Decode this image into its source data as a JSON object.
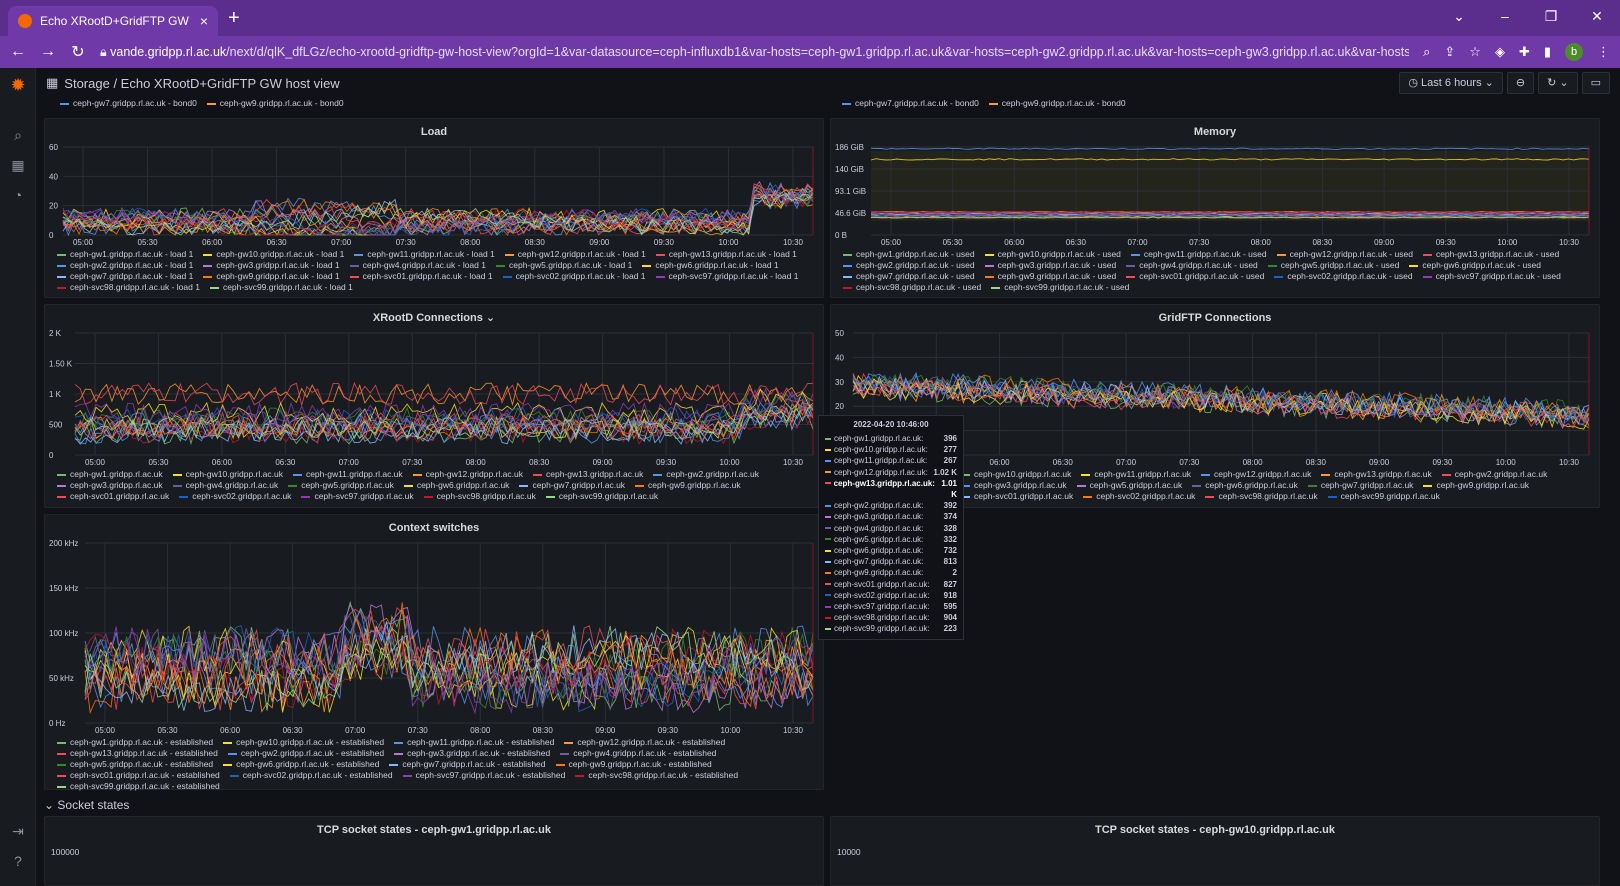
{
  "browser": {
    "tab_title": "Echo XRootD+GridFTP GW host",
    "tab_close": "×",
    "new_tab": "+",
    "url_host": "vande.gridpp.rl.ac.uk",
    "url_rest": "/next/d/qlK_dfLGz/echo-xrootd-gridftp-gw-host-view?orgId=1&var-datasource=ceph-influxdb1&var-hosts=ceph-gw1.gridpp.rl.ac.uk&var-hosts=ceph-gw2.gridpp.rl.ac.uk&var-hosts=ceph-gw3.gridpp.rl.ac.uk&var-hosts=c...",
    "avatar_letter": "b"
  },
  "grafana": {
    "breadcrumb": "Storage / Echo XRootD+GridFTP GW host view",
    "time_range": "Last 6 hours",
    "section_socket": "Socket states"
  },
  "time_ticks": [
    "05:00",
    "05:30",
    "06:00",
    "06:30",
    "07:00",
    "07:30",
    "08:00",
    "08:30",
    "09:00",
    "09:30",
    "10:00",
    "10:30"
  ],
  "colors": [
    "#73bf69",
    "#fade2a",
    "#5794f2",
    "#ff9830",
    "#f2495c",
    "#5794f2",
    "#b877d9",
    "#705da0",
    "#37872d",
    "#fade2a",
    "#8ab8ff",
    "#ff780a",
    "#f2495c",
    "#1f60c4",
    "#8f3bb8",
    "#c4162a",
    "#96d98d",
    "#ffb357",
    "#ca95e5"
  ],
  "panels": {
    "load": {
      "title": "Load",
      "yticks": [
        "60",
        "40",
        "20",
        "0"
      ],
      "legend": [
        "ceph-gw1.gridpp.rl.ac.uk - load 1",
        "ceph-gw10.gridpp.rl.ac.uk - load 1",
        "ceph-gw11.gridpp.rl.ac.uk - load 1",
        "ceph-gw12.gridpp.rl.ac.uk - load 1",
        "ceph-gw13.gridpp.rl.ac.uk - load 1",
        "ceph-gw2.gridpp.rl.ac.uk - load 1",
        "ceph-gw3.gridpp.rl.ac.uk - load 1",
        "ceph-gw4.gridpp.rl.ac.uk - load 1",
        "ceph-gw5.gridpp.rl.ac.uk - load 1",
        "ceph-gw6.gridpp.rl.ac.uk - load 1",
        "ceph-gw7.gridpp.rl.ac.uk - load 1",
        "ceph-gw9.gridpp.rl.ac.uk - load 1",
        "ceph-svc01.gridpp.rl.ac.uk - load 1",
        "ceph-svc02.gridpp.rl.ac.uk - load 1",
        "ceph-svc97.gridpp.rl.ac.uk - load 1",
        "ceph-svc98.gridpp.rl.ac.uk - load 1",
        "ceph-svc99.gridpp.rl.ac.uk - load 1"
      ]
    },
    "memory": {
      "title": "Memory",
      "yticks": [
        "186 GiB",
        "140 GiB",
        "93.1 GiB",
        "46.6 GiB",
        "0 B"
      ],
      "legend": [
        "ceph-gw1.gridpp.rl.ac.uk - used",
        "ceph-gw10.gridpp.rl.ac.uk - used",
        "ceph-gw11.gridpp.rl.ac.uk - used",
        "ceph-gw12.gridpp.rl.ac.uk - used",
        "ceph-gw13.gridpp.rl.ac.uk - used",
        "ceph-gw2.gridpp.rl.ac.uk - used",
        "ceph-gw3.gridpp.rl.ac.uk - used",
        "ceph-gw4.gridpp.rl.ac.uk - used",
        "ceph-gw5.gridpp.rl.ac.uk - used",
        "ceph-gw6.gridpp.rl.ac.uk - used",
        "ceph-gw7.gridpp.rl.ac.uk - used",
        "ceph-gw9.gridpp.rl.ac.uk - used",
        "ceph-svc01.gridpp.rl.ac.uk - used",
        "ceph-svc02.gridpp.rl.ac.uk - used",
        "ceph-svc97.gridpp.rl.ac.uk - used",
        "ceph-svc98.gridpp.rl.ac.uk - used",
        "ceph-svc99.gridpp.rl.ac.uk - used"
      ]
    },
    "xrootd": {
      "title": "XRootD Connections",
      "yticks": [
        "2 K",
        "1.50 K",
        "1 K",
        "500",
        "0"
      ],
      "legend": [
        "ceph-gw1.gridpp.rl.ac.uk",
        "ceph-gw10.gridpp.rl.ac.uk",
        "ceph-gw11.gridpp.rl.ac.uk",
        "ceph-gw12.gridpp.rl.ac.uk",
        "ceph-gw13.gridpp.rl.ac.uk",
        "ceph-gw2.gridpp.rl.ac.uk",
        "ceph-gw3.gridpp.rl.ac.uk",
        "ceph-gw4.gridpp.rl.ac.uk",
        "ceph-gw5.gridpp.rl.ac.uk",
        "ceph-gw6.gridpp.rl.ac.uk",
        "ceph-gw7.gridpp.rl.ac.uk",
        "ceph-gw9.gridpp.rl.ac.uk",
        "ceph-svc01.gridpp.rl.ac.uk",
        "ceph-svc02.gridpp.rl.ac.uk",
        "ceph-svc97.gridpp.rl.ac.uk",
        "ceph-svc98.gridpp.rl.ac.uk",
        "ceph-svc99.gridpp.rl.ac.uk"
      ]
    },
    "gridftp": {
      "title": "GridFTP Connections",
      "yticks": [
        "50",
        "40",
        "30",
        "20",
        "10",
        "0"
      ],
      "legend": [
        "ceph-gw10.gridpp.rl.ac.uk",
        "ceph-gw11.gridpp.rl.ac.uk",
        "ceph-gw12.gridpp.rl.ac.uk",
        "ceph-gw13.gridpp.rl.ac.uk",
        "ceph-gw2.gridpp.rl.ac.uk",
        "ceph-gw3.gridpp.rl.ac.uk",
        "ceph-gw5.gridpp.rl.ac.uk",
        "ceph-gw6.gridpp.rl.ac.uk",
        "ceph-gw7.gridpp.rl.ac.uk",
        "ceph-gw9.gridpp.rl.ac.uk",
        "ceph-svc01.gridpp.rl.ac.uk",
        "ceph-svc02.gridpp.rl.ac.uk",
        "ceph-svc98.gridpp.rl.ac.uk",
        "ceph-svc99.gridpp.rl.ac.uk"
      ]
    },
    "ctx": {
      "title": "Context switches",
      "yticks": [
        "200 kHz",
        "150 kHz",
        "100 kHz",
        "50 kHz",
        "0 Hz"
      ],
      "legend": [
        "ceph-gw1.gridpp.rl.ac.uk - established",
        "ceph-gw10.gridpp.rl.ac.uk - established",
        "ceph-gw11.gridpp.rl.ac.uk - established",
        "ceph-gw12.gridpp.rl.ac.uk - established",
        "ceph-gw13.gridpp.rl.ac.uk - established",
        "ceph-gw2.gridpp.rl.ac.uk - established",
        "ceph-gw3.gridpp.rl.ac.uk - established",
        "ceph-gw4.gridpp.rl.ac.uk - established",
        "ceph-gw5.gridpp.rl.ac.uk - established",
        "ceph-gw6.gridpp.rl.ac.uk - established",
        "ceph-gw7.gridpp.rl.ac.uk - established",
        "ceph-gw9.gridpp.rl.ac.uk - established",
        "ceph-svc01.gridpp.rl.ac.uk - established",
        "ceph-svc02.gridpp.rl.ac.uk - established",
        "ceph-svc97.gridpp.rl.ac.uk - established",
        "ceph-svc98.gridpp.rl.ac.uk - established",
        "ceph-svc99.gridpp.rl.ac.uk - established"
      ]
    },
    "tcp1": {
      "title": "TCP socket states - ceph-gw1.gridpp.rl.ac.uk",
      "ytick": "100000"
    },
    "tcp2": {
      "title": "TCP socket states - ceph-gw10.gridpp.rl.ac.uk",
      "ytick": "10000"
    }
  },
  "top_legend_left": [
    "ceph-gw7.gridpp.rl.ac.uk - bond0",
    "ceph-gw9.gridpp.rl.ac.uk - bond0"
  ],
  "top_legend_right": [
    "ceph-gw7.gridpp.rl.ac.uk - bond0",
    "ceph-gw9.gridpp.rl.ac.uk - bond0"
  ],
  "tooltip": {
    "time": "2022-04-20 10:46:00",
    "rows": [
      {
        "name": "ceph-gw1.gridpp.rl.ac.uk:",
        "value": "396"
      },
      {
        "name": "ceph-gw10.gridpp.rl.ac.uk:",
        "value": "277"
      },
      {
        "name": "ceph-gw11.gridpp.rl.ac.uk:",
        "value": "267"
      },
      {
        "name": "ceph-gw12.gridpp.rl.ac.uk:",
        "value": "1.02 K"
      },
      {
        "name": "ceph-gw13.gridpp.rl.ac.uk:",
        "value": "1.01 K"
      },
      {
        "name": "ceph-gw2.gridpp.rl.ac.uk:",
        "value": "392"
      },
      {
        "name": "ceph-gw3.gridpp.rl.ac.uk:",
        "value": "374"
      },
      {
        "name": "ceph-gw4.gridpp.rl.ac.uk:",
        "value": "328"
      },
      {
        "name": "ceph-gw5.gridpp.rl.ac.uk:",
        "value": "332"
      },
      {
        "name": "ceph-gw6.gridpp.rl.ac.uk:",
        "value": "732"
      },
      {
        "name": "ceph-gw7.gridpp.rl.ac.uk:",
        "value": "813"
      },
      {
        "name": "ceph-gw9.gridpp.rl.ac.uk:",
        "value": "2"
      },
      {
        "name": "ceph-svc01.gridpp.rl.ac.uk:",
        "value": "827"
      },
      {
        "name": "ceph-svc02.gridpp.rl.ac.uk:",
        "value": "918"
      },
      {
        "name": "ceph-svc97.gridpp.rl.ac.uk:",
        "value": "595"
      },
      {
        "name": "ceph-svc98.gridpp.rl.ac.uk:",
        "value": "904"
      },
      {
        "name": "ceph-svc99.gridpp.rl.ac.uk:",
        "value": "223"
      }
    ]
  }
}
